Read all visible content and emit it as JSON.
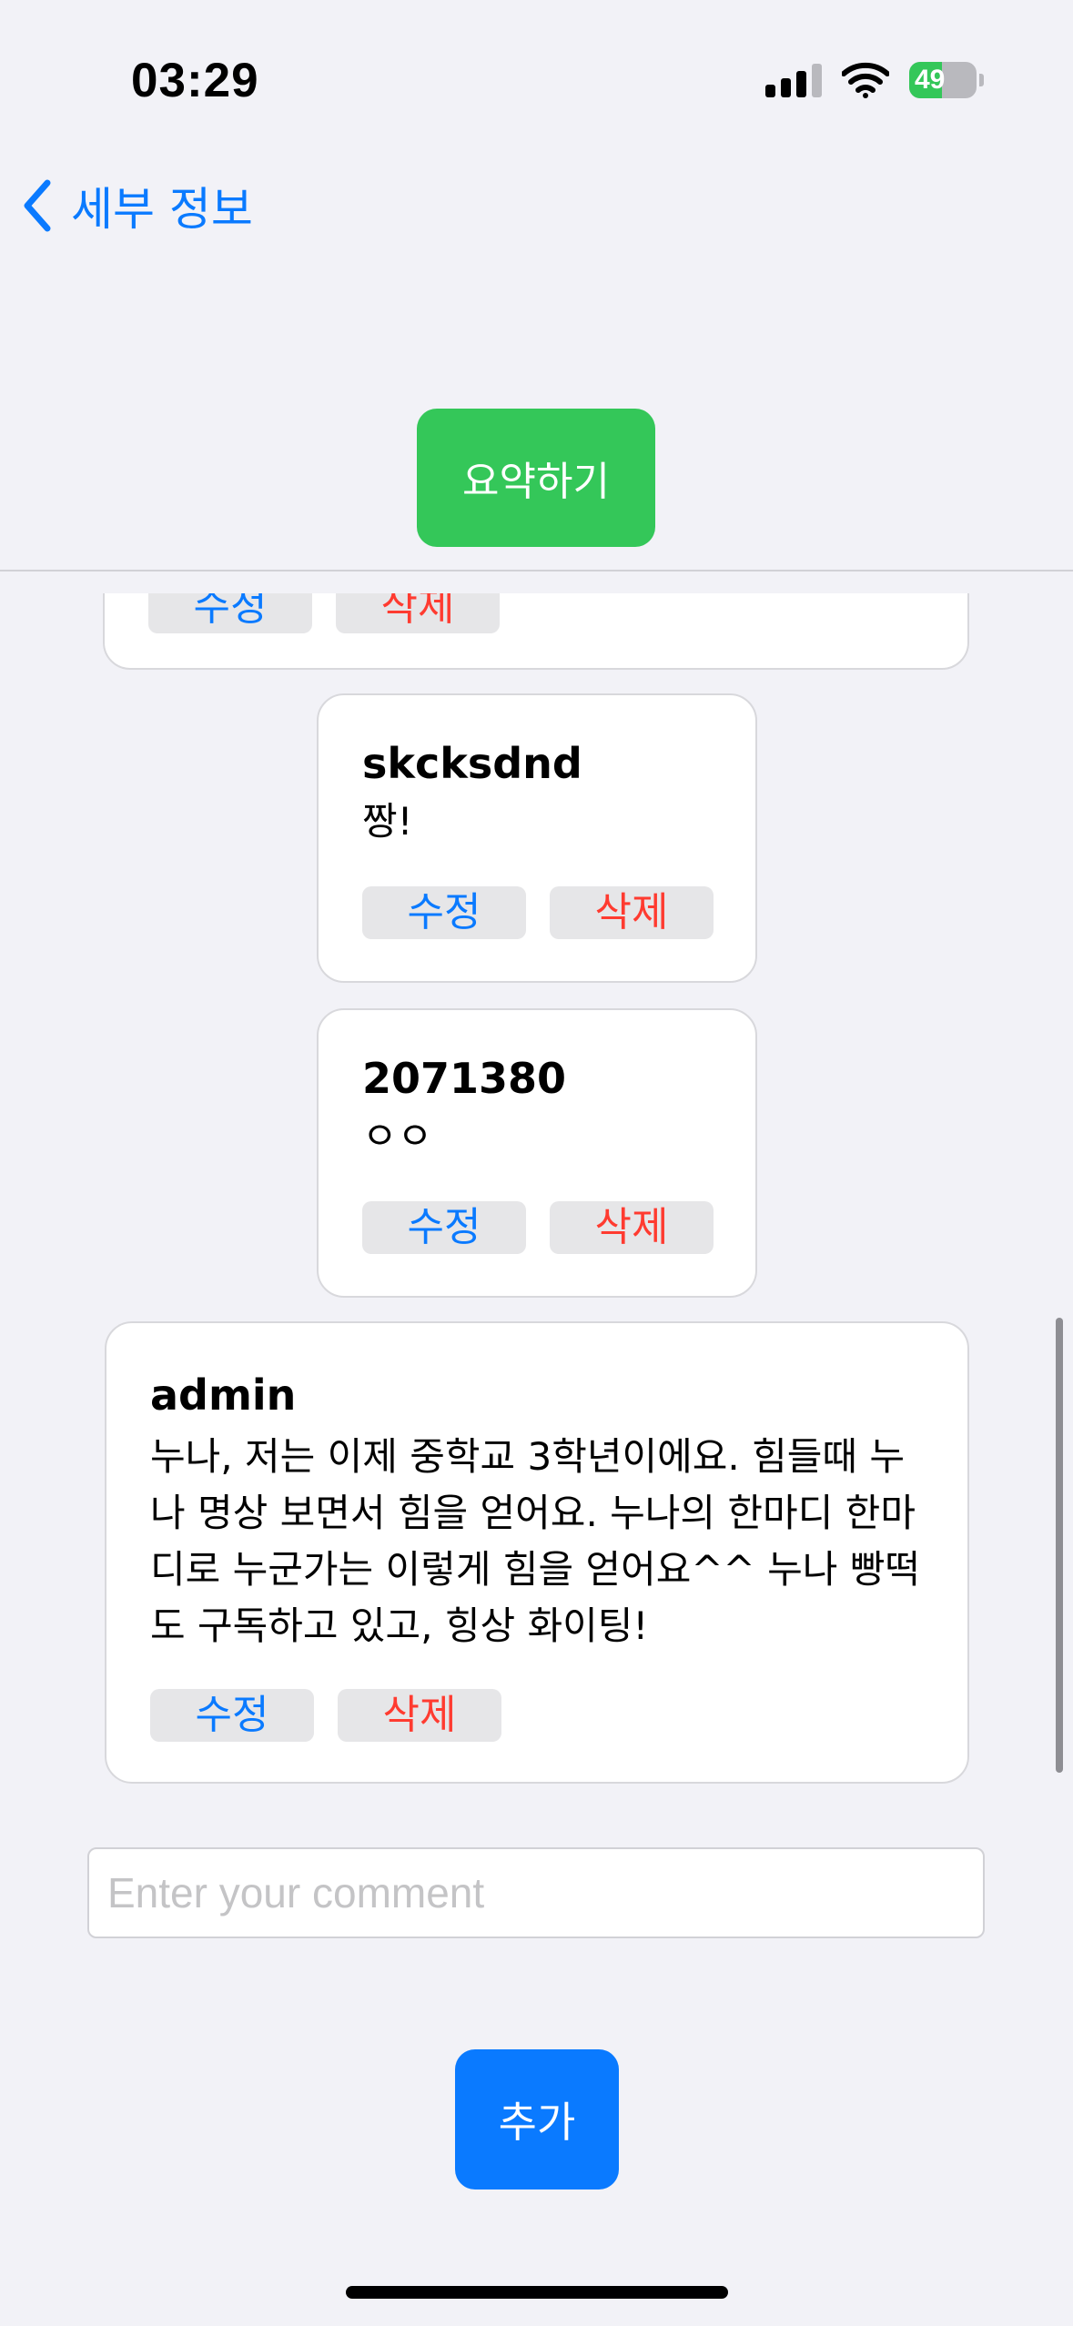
{
  "status_bar": {
    "time": "03:29",
    "battery": "49",
    "battery_level": 0.49
  },
  "nav": {
    "back_label": "세부 정보"
  },
  "summarize_button": "요약하기",
  "comments": [
    {
      "author": "",
      "text": "",
      "edit_label": "수정",
      "delete_label": "삭제"
    },
    {
      "author": "skcksdnd",
      "text": "짱!",
      "edit_label": "수정",
      "delete_label": "삭제"
    },
    {
      "author": "2071380",
      "text": "ㅇㅇ",
      "edit_label": "수정",
      "delete_label": "삭제"
    },
    {
      "author": "admin",
      "text": "누나, 저는 이제 중학교 3학년이에요. 힘들때 누나 명상 보면서 힘을 얻어요. 누나의 한마디 한마디로 누군가는 이렇게 힘을 얻어요^^ 누나 빵떡도 구독하고 있고, 힝상 화이팅!",
      "edit_label": "수정",
      "delete_label": "삭제"
    }
  ],
  "comment_input": {
    "value": "",
    "placeholder": "Enter your comment"
  },
  "add_button": "추가"
}
